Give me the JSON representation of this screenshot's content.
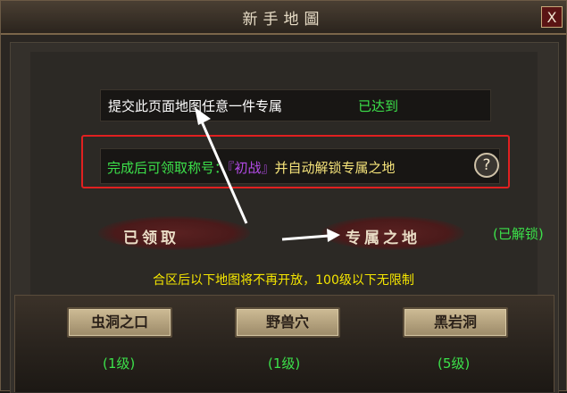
{
  "window": {
    "title": "新手地圖",
    "close_label": "X"
  },
  "requirement": {
    "text": "提交此页面地图任意一件专属",
    "status": "已达到"
  },
  "reward": {
    "prefix": "完成后可领取称号：",
    "title_name": "『初战』",
    "suffix": "并自动解锁专属之地",
    "help_icon": "?"
  },
  "status": {
    "claimed": "已领取",
    "exclusive": "专属之地",
    "unlocked": "(已解锁)"
  },
  "notice": "合区后以下地图将不再开放，100级以下无限制",
  "maps": [
    {
      "name": "虫洞之口",
      "level": "(1级)"
    },
    {
      "name": "野兽穴",
      "level": "(1级)"
    },
    {
      "name": "黑岩洞",
      "level": "(5级)"
    }
  ],
  "colors": {
    "green": "#3ce14a",
    "purple": "#b44be8",
    "yellow": "#f5e600",
    "highlight": "#e02020"
  }
}
